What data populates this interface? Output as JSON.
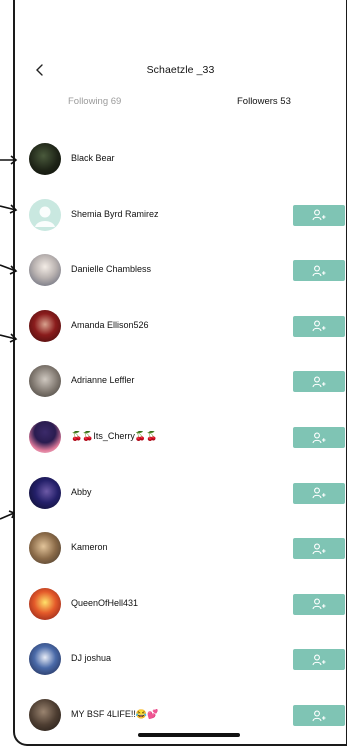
{
  "header": {
    "title": "Schaetzle _33"
  },
  "tabs": {
    "following": "Following 69",
    "followers": "Followers 53"
  },
  "colors": {
    "follow_button": "#7fc4b4",
    "inactive_tab": "#9b9b9b"
  },
  "users": [
    {
      "name": "Black Bear",
      "avatar": "dark",
      "has_follow_button": false
    },
    {
      "name": "Shemia Byrd Ramirez",
      "avatar": "default",
      "has_follow_button": true
    },
    {
      "name": "Danielle Chambless",
      "avatar": "silver",
      "has_follow_button": true
    },
    {
      "name": "Amanda Ellison526",
      "avatar": "red",
      "has_follow_button": true
    },
    {
      "name": "Adrianne Leffler",
      "avatar": "gray",
      "has_follow_button": true
    },
    {
      "name": "🍒🍒Its_Cherry🍒🍒",
      "avatar": "cartoon",
      "has_follow_button": true
    },
    {
      "name": "Abby",
      "avatar": "night",
      "has_follow_button": true
    },
    {
      "name": "Kameron",
      "avatar": "sepia",
      "has_follow_button": true
    },
    {
      "name": "QueenOfHell431",
      "avatar": "fiery",
      "has_follow_button": true
    },
    {
      "name": "DJ joshua",
      "avatar": "blue",
      "has_follow_button": true
    },
    {
      "name": "MY BSF 4LIFE!!😂💕",
      "avatar": "brown",
      "has_follow_button": true
    }
  ]
}
